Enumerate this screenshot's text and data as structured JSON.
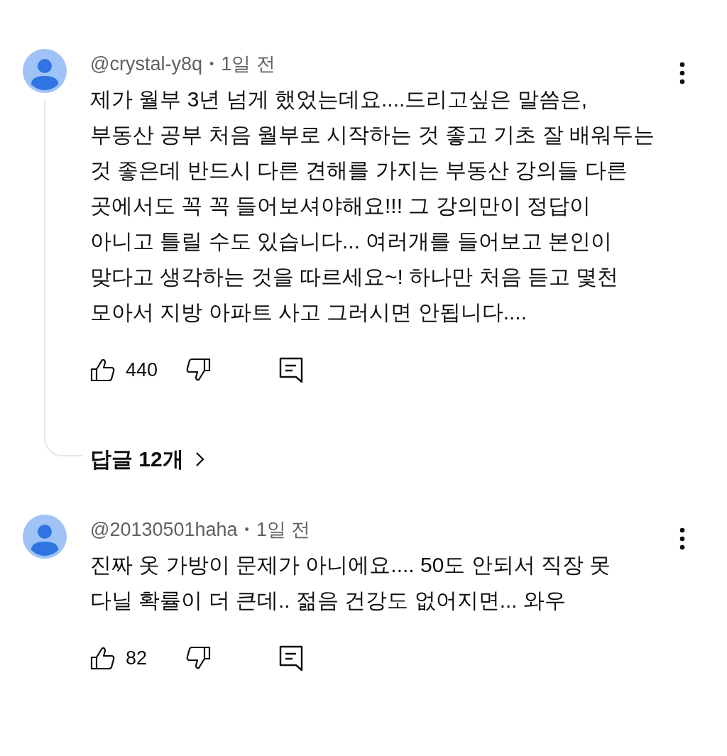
{
  "comments": [
    {
      "author": "@crystal-y8q",
      "separator": "•",
      "time": "1일 전",
      "text": "제가 월부 3년 넘게 했었는데요....드리고싶은 말씀은, 부동산 공부 처음 월부로 시작하는 것 좋고 기초 잘 배워두는 것 좋은데 반드시 다른 견해를 가지는 부동산 강의들 다른 곳에서도 꼭 꼭 들어보셔야해요!!! 그 강의만이 정답이 아니고 틀릴 수도 있습니다... 여러개를 들어보고 본인이 맞다고 생각하는 것을 따르세요~! 하나만 처음 듣고 몇천 모아서 지방 아파트 사고 그러시면 안됩니다....",
      "likes": "440",
      "replies": "답글 12개"
    },
    {
      "author": "@20130501haha",
      "separator": "•",
      "time": "1일 전",
      "text": "진짜 옷 가방이 문제가 아니에요.... 50도 안되서 직장 못 다닐 확률이 더 큰데.. 젊음 건강도 없어지면... 와우",
      "likes": "82"
    }
  ]
}
